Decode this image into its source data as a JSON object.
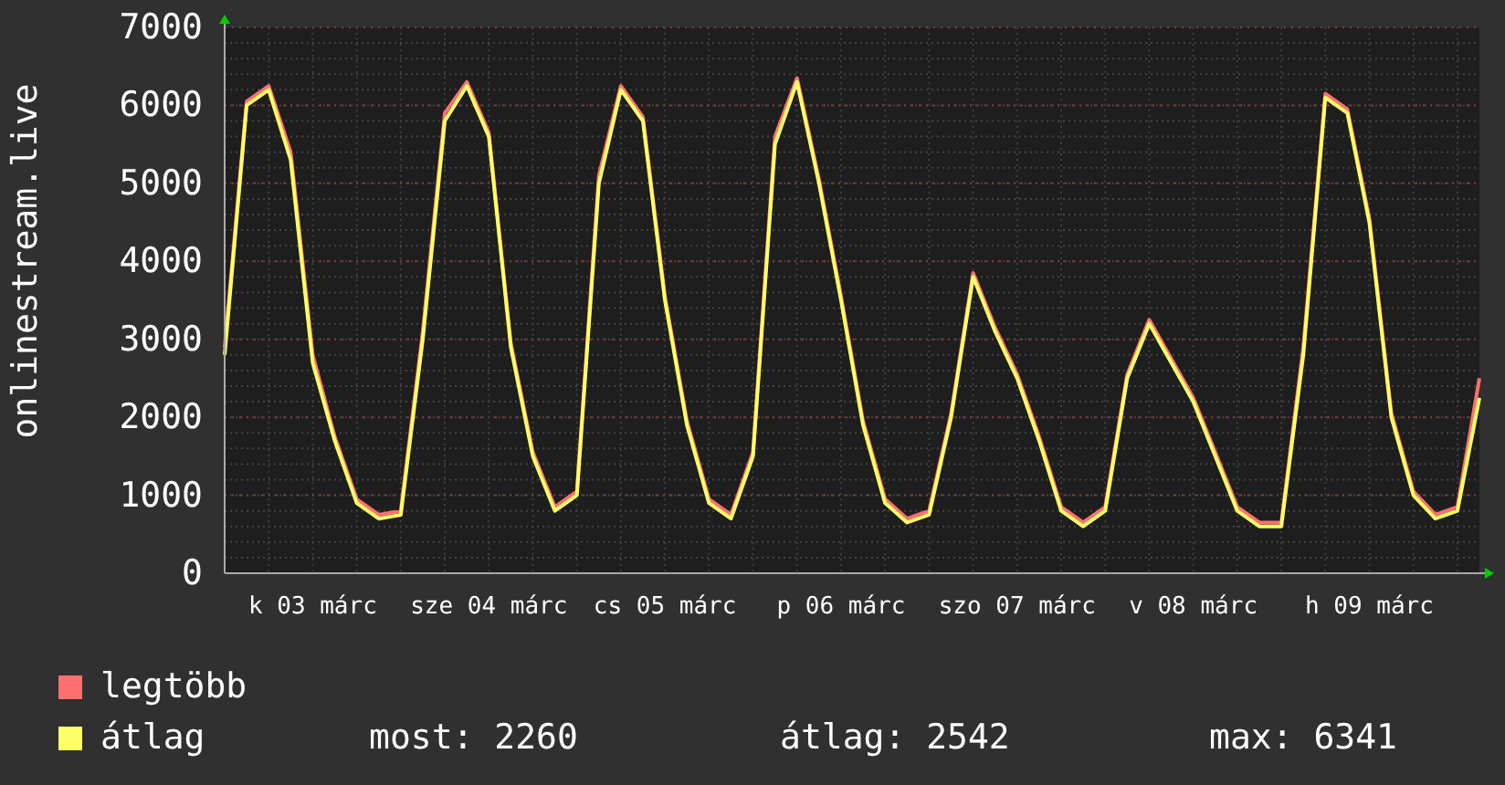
{
  "graph": {
    "chart_data": {
      "type": "line",
      "grid": true,
      "ylabel": "onlinestream.live",
      "ylim": [
        0,
        7000
      ],
      "yticks": [
        0,
        1000,
        2000,
        3000,
        4000,
        5000,
        6000,
        7000
      ],
      "categories": [
        null,
        null,
        null,
        null,
        "k 03 márc",
        null,
        null,
        null,
        null,
        null,
        null,
        null,
        "sze 04 márc",
        null,
        null,
        null,
        null,
        null,
        null,
        null,
        "cs 05 márc",
        null,
        null,
        null,
        null,
        null,
        null,
        null,
        "p 06 márc",
        null,
        null,
        null,
        null,
        null,
        null,
        null,
        "szo 07 márc",
        null,
        null,
        null,
        null,
        null,
        null,
        null,
        "v 08 márc",
        null,
        null,
        null,
        null,
        null,
        null,
        null,
        "h 09 márc",
        null,
        null,
        null,
        null,
        null
      ],
      "series": [
        {
          "name": "legtöbb",
          "color": "#ff7070",
          "values": [
            2900,
            6050,
            6250,
            5400,
            2800,
            1750,
            950,
            750,
            800,
            3100,
            5900,
            6300,
            5650,
            2950,
            1550,
            850,
            1050,
            5100,
            6250,
            5850,
            3550,
            1950,
            950,
            750,
            1550,
            5600,
            6350,
            5050,
            3550,
            1950,
            950,
            700,
            800,
            2050,
            3850,
            3150,
            2550,
            1750,
            850,
            650,
            850,
            2550,
            3250,
            2750,
            2250,
            1550,
            850,
            650,
            650,
            2900,
            6150,
            5950,
            4550,
            2050,
            1050,
            750,
            850,
            2500
          ]
        },
        {
          "name": "átlag",
          "color": "#ffff66",
          "values": [
            2800,
            6000,
            6200,
            5300,
            2700,
            1700,
            900,
            700,
            750,
            3000,
            5800,
            6250,
            5600,
            2900,
            1500,
            800,
            1000,
            5000,
            6200,
            5800,
            3500,
            1900,
            900,
            700,
            1500,
            5500,
            6300,
            5000,
            3500,
            1900,
            900,
            650,
            750,
            2000,
            3800,
            3100,
            2500,
            1700,
            800,
            600,
            800,
            2500,
            3200,
            2700,
            2200,
            1500,
            800,
            600,
            600,
            2800,
            6100,
            5900,
            4500,
            2000,
            1000,
            700,
            800,
            2250
          ]
        }
      ]
    }
  },
  "stats": [
    "most: 2260",
    "átlag: 2542",
    "max: 6341"
  ]
}
